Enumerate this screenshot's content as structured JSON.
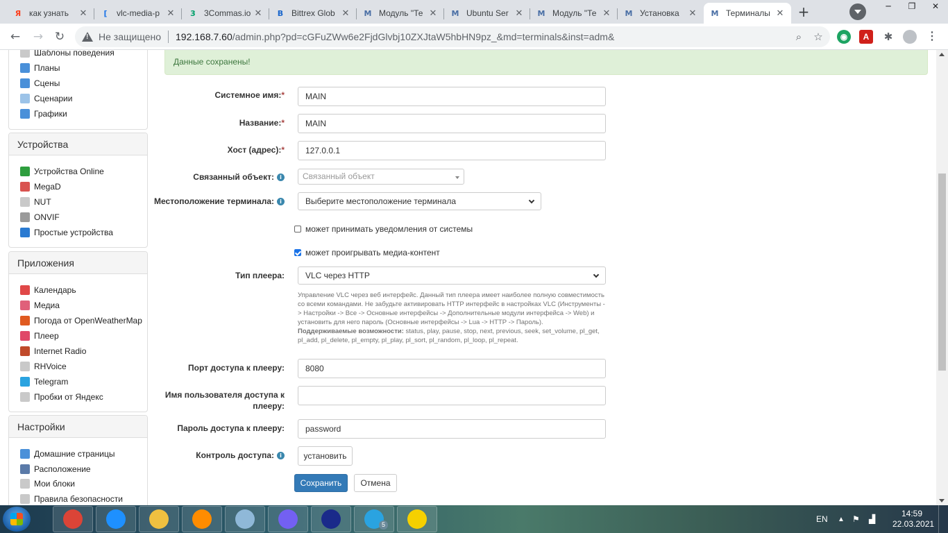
{
  "browser": {
    "tabs": [
      {
        "title": "как узнать",
        "favicon": "yandex-icon",
        "color": "#fc3f1d",
        "glyph": "Я"
      },
      {
        "title": "vlc-media-p",
        "favicon": "bracket-icon",
        "color": "#1a73e8",
        "glyph": "["
      },
      {
        "title": "3Commas.io",
        "favicon": "3commas-icon",
        "color": "#00a06a",
        "glyph": "3"
      },
      {
        "title": "Bittrex Glob",
        "favicon": "bittrex-icon",
        "color": "#1a66cc",
        "glyph": "B"
      },
      {
        "title": "Модуль \"Те",
        "favicon": "majordomo-icon",
        "color": "#4a6fa5",
        "glyph": "M"
      },
      {
        "title": "Ubuntu Ser",
        "favicon": "majordomo-icon",
        "color": "#4a6fa5",
        "glyph": "M"
      },
      {
        "title": "Модуль \"Те",
        "favicon": "majordomo-icon",
        "color": "#4a6fa5",
        "glyph": "M"
      },
      {
        "title": "Установка",
        "favicon": "majordomo-icon",
        "color": "#4a6fa5",
        "glyph": "M"
      },
      {
        "title": "Терминалы",
        "favicon": "majordomo-icon",
        "color": "#4a6fa5",
        "glyph": "M",
        "active": true
      }
    ],
    "new_tab": "+",
    "address": {
      "security_label": "Не защищено",
      "url_host": "192.168.7.60",
      "url_path": "/admin.php?pd=cGFuZWw6e2FjdGlvbj10ZXJtaW5hbHN9pz_&md=terminals&inst=adm&"
    }
  },
  "sidebar": {
    "top_items": [
      {
        "label": "Шаблоны поведения",
        "icon": "behavior-template-icon",
        "color": "#c9c9c9"
      },
      {
        "label": "Планы",
        "icon": "plans-icon",
        "color": "#4a90d9"
      },
      {
        "label": "Сцены",
        "icon": "scenes-icon",
        "color": "#4a90d9"
      },
      {
        "label": "Сценарии",
        "icon": "scenarios-icon",
        "color": "#9cc3e8"
      },
      {
        "label": "Графики",
        "icon": "charts-icon",
        "color": "#4a90d9"
      }
    ],
    "devices": {
      "title": "Устройства",
      "items": [
        {
          "label": "Устройства Online",
          "icon": "devices-online-icon",
          "color": "#2e9e3e"
        },
        {
          "label": "MegaD",
          "icon": "house-icon",
          "color": "#d9534f"
        },
        {
          "label": "NUT",
          "icon": "nut-icon",
          "color": "#c9c9c9"
        },
        {
          "label": "ONVIF",
          "icon": "onvif-icon",
          "color": "#9a9a9a"
        },
        {
          "label": "Простые устройства",
          "icon": "power-icon",
          "color": "#2a7ad1"
        }
      ]
    },
    "apps": {
      "title": "Приложения",
      "items": [
        {
          "label": "Календарь",
          "icon": "calendar-icon",
          "color": "#e04848"
        },
        {
          "label": "Медиа",
          "icon": "media-icon",
          "color": "#e0607a"
        },
        {
          "label": "Погода от OpenWeatherMap",
          "icon": "weather-icon",
          "color": "#e05a20"
        },
        {
          "label": "Плеер",
          "icon": "player-icon",
          "color": "#e04868"
        },
        {
          "label": "Internet Radio",
          "icon": "radio-icon",
          "color": "#c04a2a"
        },
        {
          "label": "RHVoice",
          "icon": "rhvoice-icon",
          "color": "#c9c9c9"
        },
        {
          "label": "Telegram",
          "icon": "telegram-icon",
          "color": "#2aa3e0"
        },
        {
          "label": "Пробки от Яндекс",
          "icon": "traffic-icon",
          "color": "#c9c9c9"
        }
      ]
    },
    "settings": {
      "title": "Настройки",
      "items": [
        {
          "label": "Домашние страницы",
          "icon": "home-pages-icon",
          "color": "#4a90d9"
        },
        {
          "label": "Расположение",
          "icon": "location-icon",
          "color": "#5a7aa8"
        },
        {
          "label": "Мои блоки",
          "icon": "blocks-icon",
          "color": "#c9c9c9"
        },
        {
          "label": "Правила безопасности",
          "icon": "security-icon",
          "color": "#c9c9c9"
        }
      ]
    }
  },
  "alert": {
    "text": "Данные сохранены!"
  },
  "form": {
    "system_name": {
      "label": "Системное имя:",
      "value": "MAIN"
    },
    "title": {
      "label": "Название:",
      "value": "MAIN"
    },
    "host": {
      "label": "Хост (адрес):",
      "value": "127.0.0.1"
    },
    "linked_object": {
      "label": "Связанный объект:",
      "placeholder": "Связанный объект"
    },
    "location": {
      "label": "Местоположение терминала:",
      "value": "Выберите местоположение терминала"
    },
    "can_notify": {
      "label": "может принимать уведомления от системы",
      "checked": false
    },
    "can_play": {
      "label": "может проигрывать медиа-контент",
      "checked": true
    },
    "player_type": {
      "label": "Тип плеера:",
      "value": "VLC через HTTP"
    },
    "help_text": "Управление VLC через веб интерфейс. Данный тип плеера имеет наиболее полную совместимость со всеми командами. Не забудьте активировать HTTP интерфейс в настройках VLC (Инструменты -> Настройки -> Все -> Основные интерфейсы -> Дополнительные модули интерфейса -> Web) и установить для него пароль (Основные интерфейсы -> Lua -> HTTP -> Пароль).",
    "help_caps_label": "Поддерживаемые возможности:",
    "help_caps": "status, play, pause, stop, next, previous, seek, set_volume, pl_get, pl_add, pl_delete, pl_empty, pl_play, pl_sort, pl_random, pl_loop, pl_repeat.",
    "port": {
      "label": "Порт доступа к плееру:",
      "value": "8080"
    },
    "username": {
      "label_line1": "Имя пользователя доступа к",
      "label_line2": "плееру:",
      "value": ""
    },
    "password": {
      "label": "Пароль доступа к плееру:",
      "value": "password"
    },
    "access_control": {
      "label": "Контроль доступа:",
      "button": "установить"
    },
    "save": "Сохранить",
    "cancel": "Отмена",
    "required_mark": "*",
    "info_glyph": "i"
  },
  "taskbar": {
    "apps": [
      {
        "name": "chrome-icon",
        "color": "#db4437"
      },
      {
        "name": "ie-icon",
        "color": "#1e90ff"
      },
      {
        "name": "explorer-icon",
        "color": "#f0c040"
      },
      {
        "name": "media-player-icon",
        "color": "#ff8c00"
      },
      {
        "name": "notepad-icon",
        "color": "#8fb8d8"
      },
      {
        "name": "viber-icon",
        "color": "#7360f2"
      },
      {
        "name": "floppy-save-icon",
        "color": "#1a2a8a"
      },
      {
        "name": "telegram-icon",
        "color": "#2aa3e0",
        "badge": "5"
      },
      {
        "name": "batman-icon",
        "color": "#f5d000"
      }
    ],
    "lang": "EN",
    "time": "14:59",
    "date": "22.03.2021"
  }
}
